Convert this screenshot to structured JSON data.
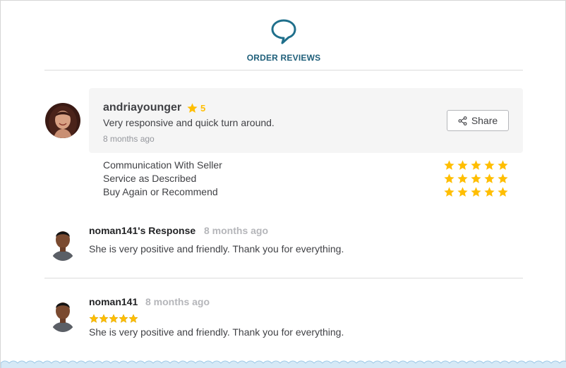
{
  "header": {
    "title": "ORDER REVIEWS",
    "icon": "speech-bubble-icon",
    "accent_color": "#1f5f7a"
  },
  "review": {
    "reviewer": "andriayounger",
    "score": "5",
    "text": "Very responsive and quick turn around.",
    "time": "8 months ago",
    "share_label": "Share",
    "star_color": "#ffbe00",
    "criteria": [
      {
        "label": "Communication With Seller",
        "stars": 5
      },
      {
        "label": "Service as Described",
        "stars": 5
      },
      {
        "label": "Buy Again or Recommend",
        "stars": 5
      }
    ]
  },
  "seller_response": {
    "title": "noman141's Response",
    "time": "8 months ago",
    "text": "She is very positive and friendly. Thank you for everything."
  },
  "second_review": {
    "reviewer": "noman141",
    "time": "8 months ago",
    "stars": 5,
    "text": "She is very positive and friendly. Thank you for everything."
  }
}
